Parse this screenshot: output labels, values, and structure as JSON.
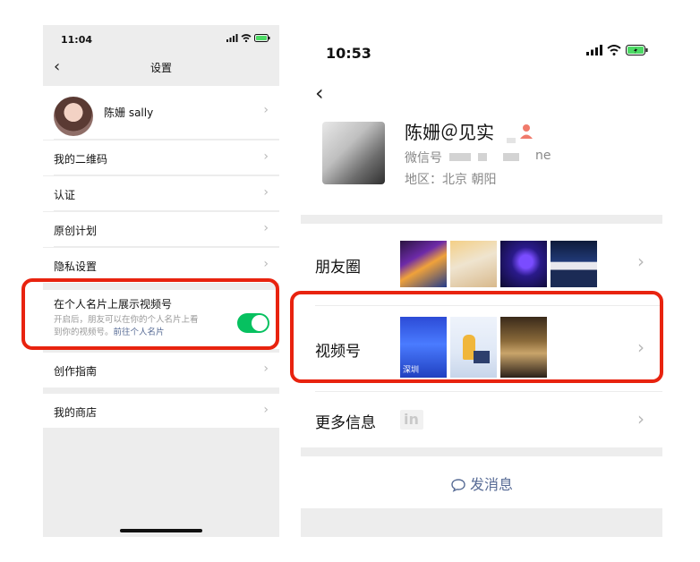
{
  "left_phone": {
    "status_time": "11:04",
    "nav_title": "设置",
    "profile_name": "陈姗 sally",
    "rows": [
      {
        "label": "我的二维码"
      },
      {
        "label": "认证"
      },
      {
        "label": "原创计划"
      },
      {
        "label": "隐私设置"
      }
    ],
    "toggle_row": {
      "title": "在个人名片上展示视频号",
      "desc_line1": "开启后，朋友可以在你的个人名片上看",
      "desc_line2_prefix": "到你的视频号。",
      "desc_link": "前往个人名片",
      "enabled": true
    },
    "creation_guide": "创作指南",
    "my_shop": "我的商店"
  },
  "right_phone": {
    "status_time": "10:53",
    "name": "陈姗＠见实",
    "wechat_label": "微信号",
    "wechat_id_suffix": "ne",
    "region": "地区：北京 朝阳",
    "moments_label": "朋友圈",
    "channels_label": "视频号",
    "more_info_label": "更多信息",
    "linkedin_badge": "in",
    "thumb_text_shenzhen": "深圳",
    "send_message": "发消息"
  },
  "colors": {
    "toggle_on": "#07c160",
    "link": "#576b95",
    "highlight": "#e8230f",
    "group_bg": "#ededed"
  }
}
